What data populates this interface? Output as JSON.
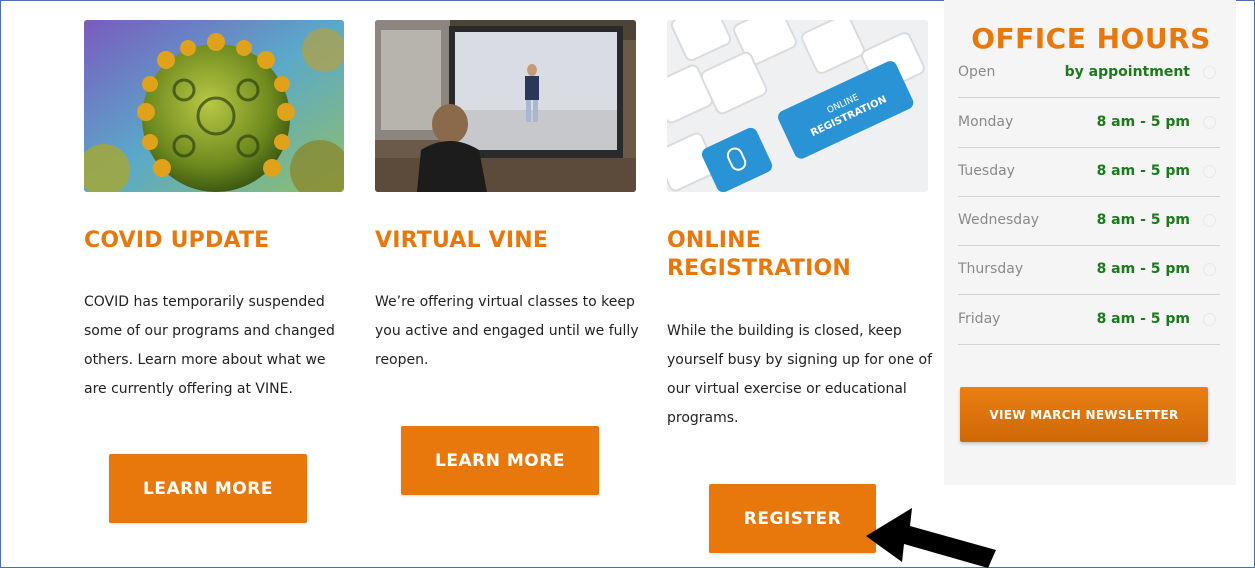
{
  "cards": [
    {
      "image_icon": "coronavirus-image",
      "title": "COVID UPDATE",
      "text": "COVID has temporarily suspended some of our programs and changed others.  Learn more about what we are currently offering at VINE.",
      "button": "LEARN MORE"
    },
    {
      "image_icon": "virtual-class-image",
      "title": "VIRTUAL VINE",
      "text": "We’re offering virtual classes to keep you active and engaged until we fully reopen.",
      "button": "LEARN MORE"
    },
    {
      "image_icon": "keyboard-image",
      "image_key_text": "ONLINE REGISTRATION",
      "title": "ONLINE REGISTRATION",
      "text": "While the building is closed, keep yourself busy by signing up for one of our virtual exercise or educational programs.",
      "button": "REGISTER"
    }
  ],
  "office_hours": {
    "title": "OFFICE HOURS",
    "rows": [
      {
        "day": "Open",
        "time": "by appointment"
      },
      {
        "day": "Monday",
        "time": "8 am - 5 pm"
      },
      {
        "day": "Tuesday",
        "time": "8 am - 5 pm"
      },
      {
        "day": "Wednesday",
        "time": "8 am - 5 pm"
      },
      {
        "day": "Thursday",
        "time": "8 am - 5 pm"
      },
      {
        "day": "Friday",
        "time": "8 am - 5 pm"
      }
    ],
    "newsletter_button": "VIEW MARCH NEWSLETTER"
  },
  "annotation": {
    "icon": "pointer-arrow-icon"
  },
  "colors": {
    "accent": "#e8780b",
    "hours_time": "#1b7a1b",
    "frame_border": "#4a6fb5"
  }
}
